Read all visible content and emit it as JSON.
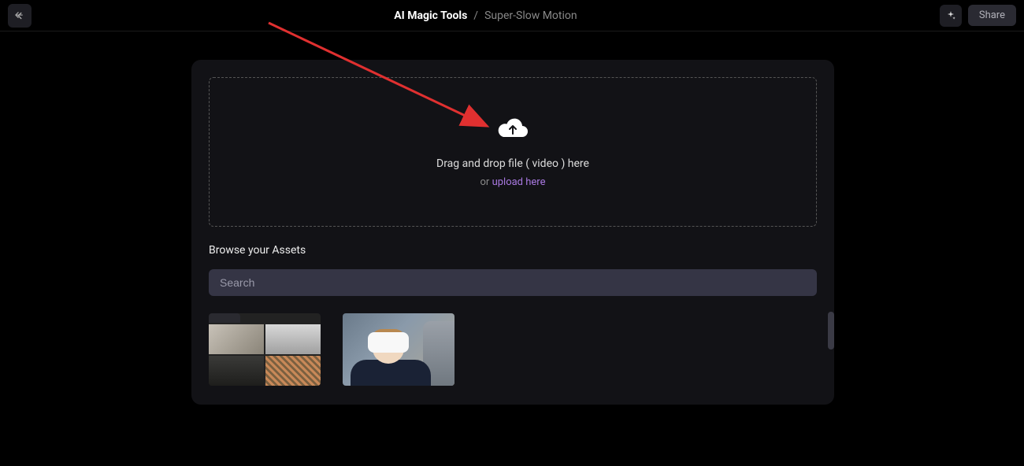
{
  "header": {
    "breadcrumb_main": "AI Magic Tools",
    "breadcrumb_separator": "/",
    "breadcrumb_sub": "Super-Slow Motion",
    "share_label": "Share"
  },
  "dropzone": {
    "main_text": "Drag and drop file ( video ) here",
    "or_text": "or ",
    "upload_link": "upload here"
  },
  "assets": {
    "browse_label": "Browse your Assets",
    "search_placeholder": "Search"
  }
}
